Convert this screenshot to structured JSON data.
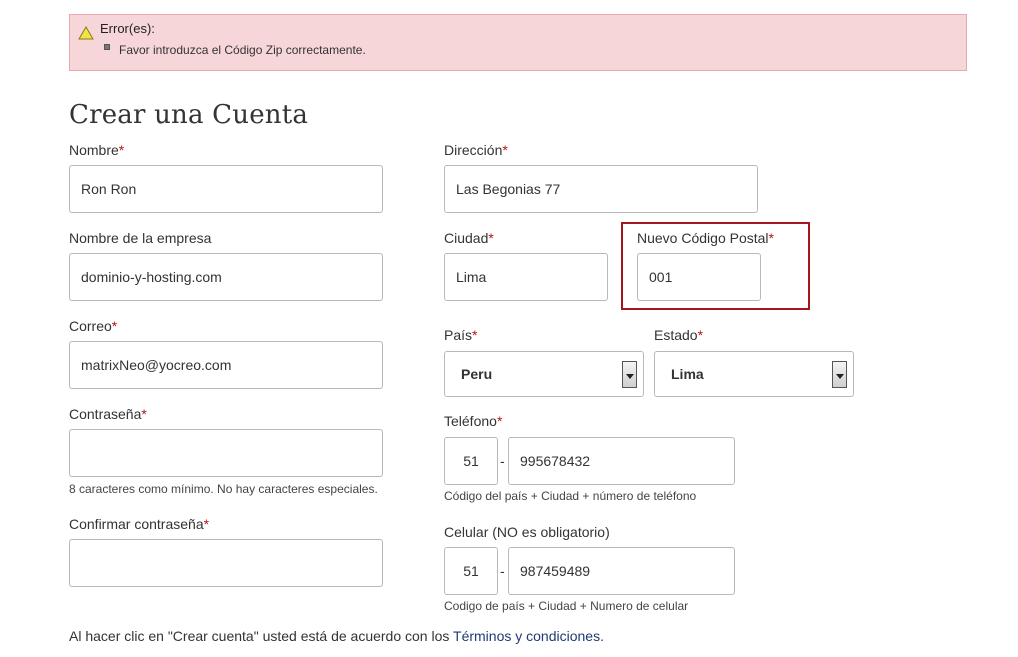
{
  "error": {
    "title": "Error(es):",
    "message": "Favor introduzca el Código Zip correctamente."
  },
  "form": {
    "title": "Crear una Cuenta",
    "required_mark": "*",
    "nombre": {
      "label": "Nombre",
      "value": "Ron Ron"
    },
    "empresa": {
      "label": "Nombre de la empresa",
      "value": "dominio-y-hosting.com"
    },
    "correo": {
      "label": "Correo",
      "value": "matrixNeo@yocreo.com"
    },
    "contrasena": {
      "label": "Contraseña",
      "value": "",
      "hint": "8 caracteres como mínimo. No hay caracteres especiales."
    },
    "confirmar": {
      "label": "Confirmar contraseña",
      "value": ""
    },
    "direccion": {
      "label": "Dirección",
      "value": "Las Begonias 77"
    },
    "ciudad": {
      "label": "Ciudad",
      "value": "Lima"
    },
    "codigo_postal": {
      "label": "Nuevo Código Postal",
      "value": "001"
    },
    "pais": {
      "label": "País",
      "value": "Peru"
    },
    "estado": {
      "label": "Estado",
      "value": "Lima"
    },
    "telefono": {
      "label": "Teléfono",
      "country": "51",
      "number": "995678432",
      "hint": "Código del país + Ciudad + número de teléfono"
    },
    "celular": {
      "label": "Celular (NO es obligatorio)",
      "country": "51",
      "number": "987459489",
      "hint": "Codigo de país + Ciudad + Numero de celular"
    },
    "separator": "-",
    "terms_prefix": "Al hacer clic en \"Crear cuenta\" usted está de acuerdo con los ",
    "terms_link": "Términos y condiciones",
    "terms_suffix": "."
  },
  "colors": {
    "error_bg": "#f6d6d8",
    "error_border": "#e7a9ad",
    "required": "#b5141b",
    "highlight": "#a3171c",
    "link": "#1f3b73"
  }
}
